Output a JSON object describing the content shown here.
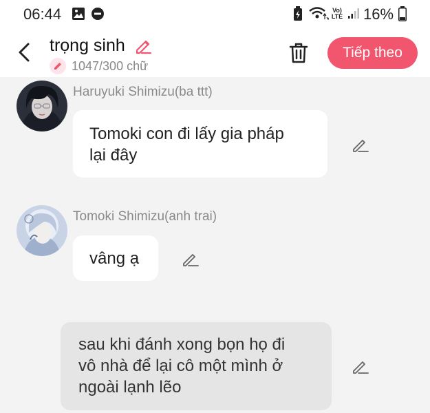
{
  "status_bar": {
    "time": "06:44",
    "network": "Vo) LTE",
    "battery": "16%"
  },
  "header": {
    "title": "trọng sinh",
    "word_count": "1047/300 chữ",
    "next_label": "Tiếp theo",
    "accent_color": "#f2566f"
  },
  "messages": [
    {
      "type": "character",
      "name": "Haruyuki Shimizu(ba ttt)",
      "lines": [
        "Tomoki con đi lấy gia pháp",
        "lại đây"
      ]
    },
    {
      "type": "character",
      "name": "Tomoki Shimizu(anh trai)",
      "lines": [
        "vâng ạ"
      ]
    },
    {
      "type": "narration",
      "lines": [
        "sau khi đánh xong bọn họ đi",
        "vô nhà để lại cô một mình ở",
        "ngoài lạnh lẽo"
      ]
    }
  ]
}
